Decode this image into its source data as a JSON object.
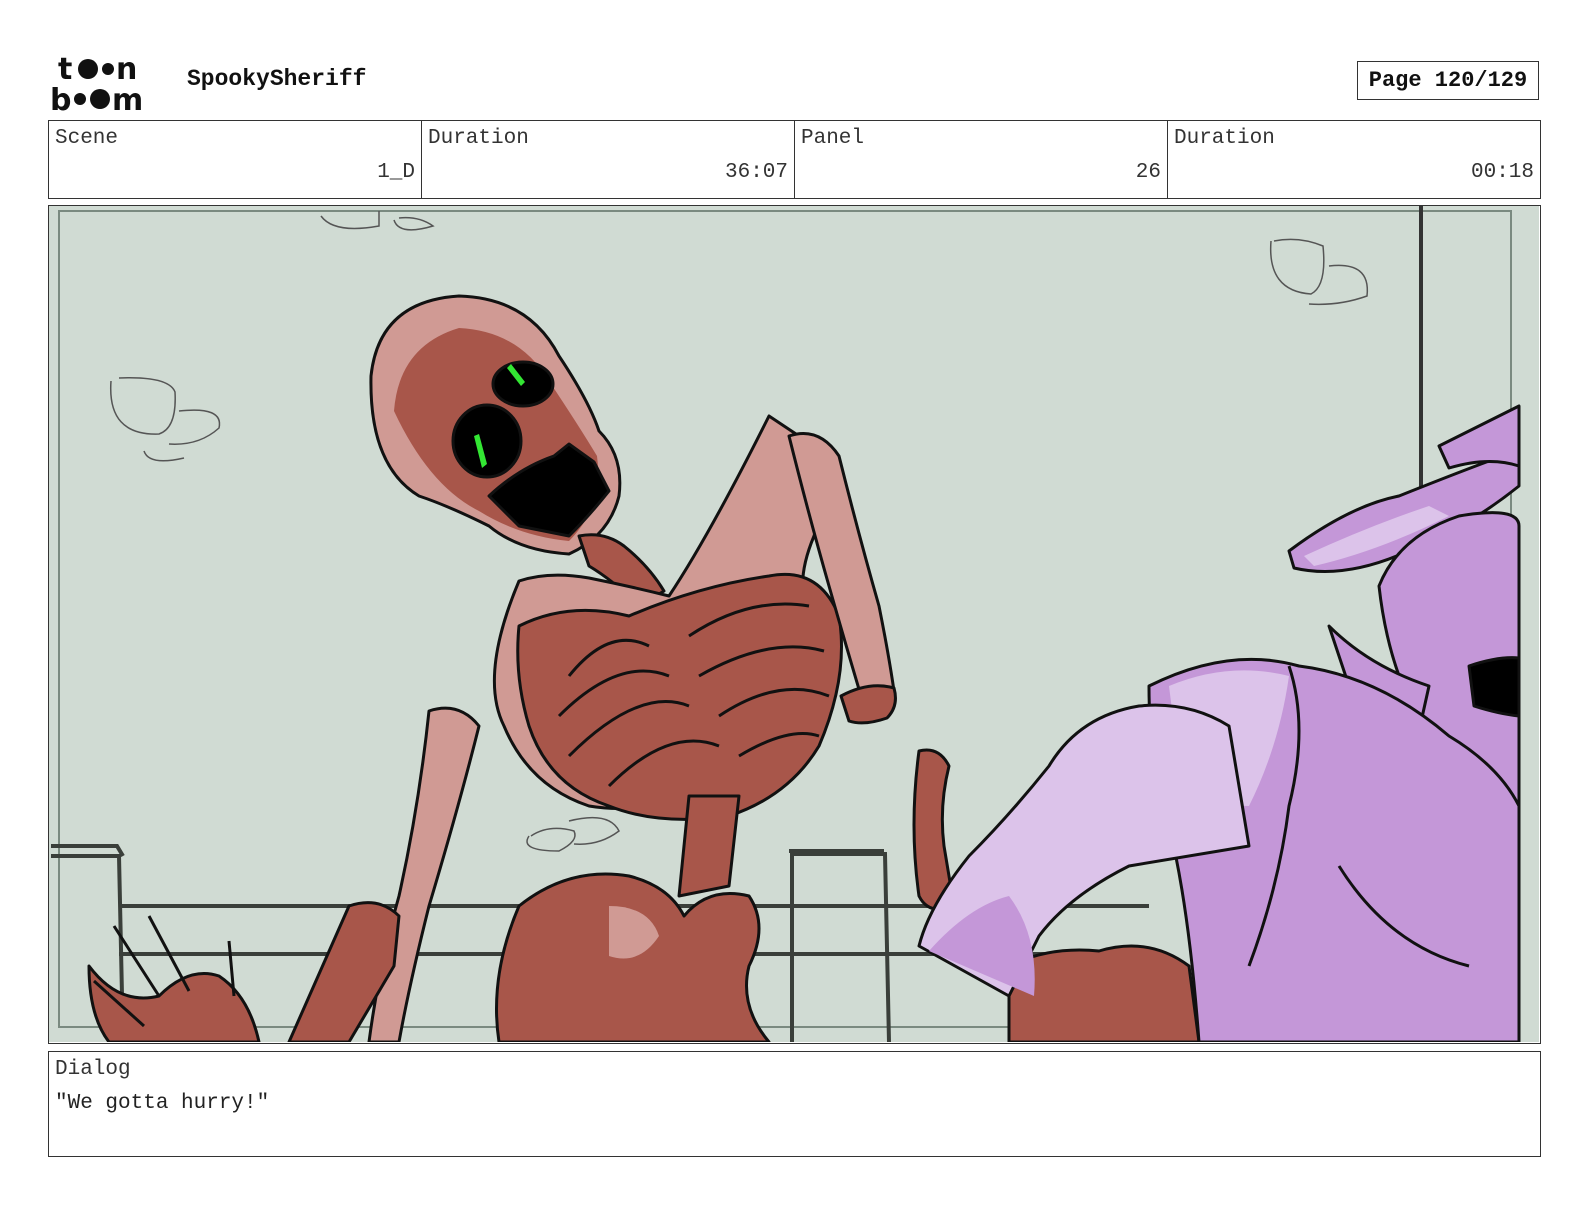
{
  "header": {
    "logo_text": "toon boom",
    "project_title": "SpookySheriff",
    "page_label": "Page 120/129"
  },
  "info": {
    "scene_label": "Scene",
    "scene_value": "1_D",
    "scene_duration_label": "Duration",
    "scene_duration_value": "36:07",
    "panel_label": "Panel",
    "panel_value": "26",
    "panel_duration_label": "Duration",
    "panel_duration_value": "00:18"
  },
  "panel": {
    "background_color": "#d0dbd3",
    "skeleton_color": "#a8564a",
    "skeleton_highlight": "#d09a94",
    "sheriff_color": "#c497d8",
    "sheriff_highlight": "#dcc3ea",
    "eye_color": "#33e633"
  },
  "dialog": {
    "label": "Dialog",
    "text": "\"We gotta hurry!\""
  }
}
